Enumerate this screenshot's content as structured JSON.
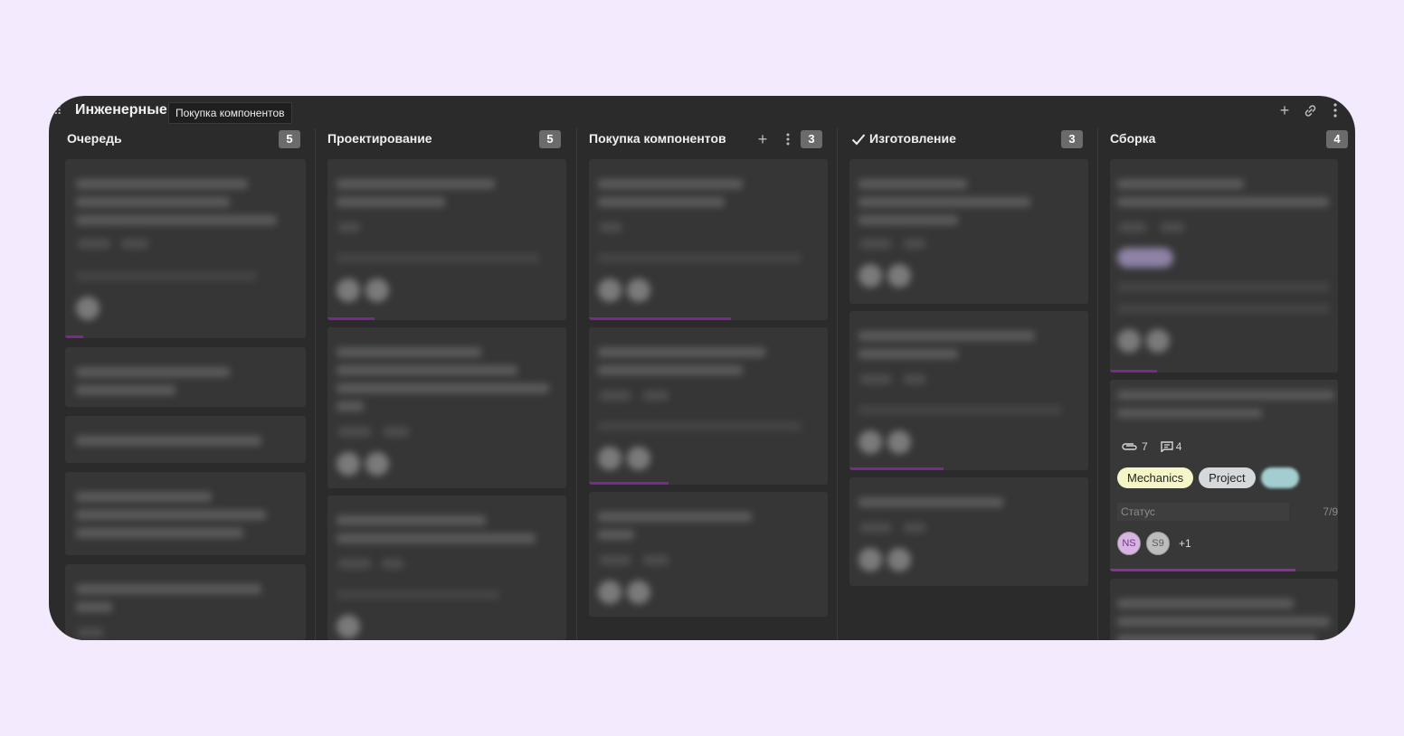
{
  "board": {
    "title": "Инженерные",
    "tooltip": "Покупка компонентов"
  },
  "columns": [
    {
      "title": "Очередь",
      "count": "5"
    },
    {
      "title": "Проектирование",
      "count": "5"
    },
    {
      "title": "Покупка компонентов",
      "count": "3"
    },
    {
      "title": "Изготовление",
      "count": "3",
      "done": true
    },
    {
      "title": "Сборка",
      "count": "4"
    }
  ],
  "focused_card": {
    "attachments": "7",
    "comments": "4",
    "tags": [
      "Mechanics",
      "Project"
    ],
    "status_label": "Статус",
    "status_count": "7/9",
    "avatars": [
      "NS",
      "S9"
    ],
    "more_avatars": "+1"
  },
  "colors": {
    "background": "#f3eafd",
    "board": "#2b2b2b",
    "card": "#363636",
    "accent": "#8d2ea0",
    "tag_mechanics": "#f4f6c7",
    "tag_project": "#d6d9dc"
  },
  "icons": [
    "drag-handle-icon",
    "plus-icon",
    "link-icon",
    "more-vertical-icon",
    "check-icon",
    "paperclip-icon",
    "comment-icon"
  ]
}
